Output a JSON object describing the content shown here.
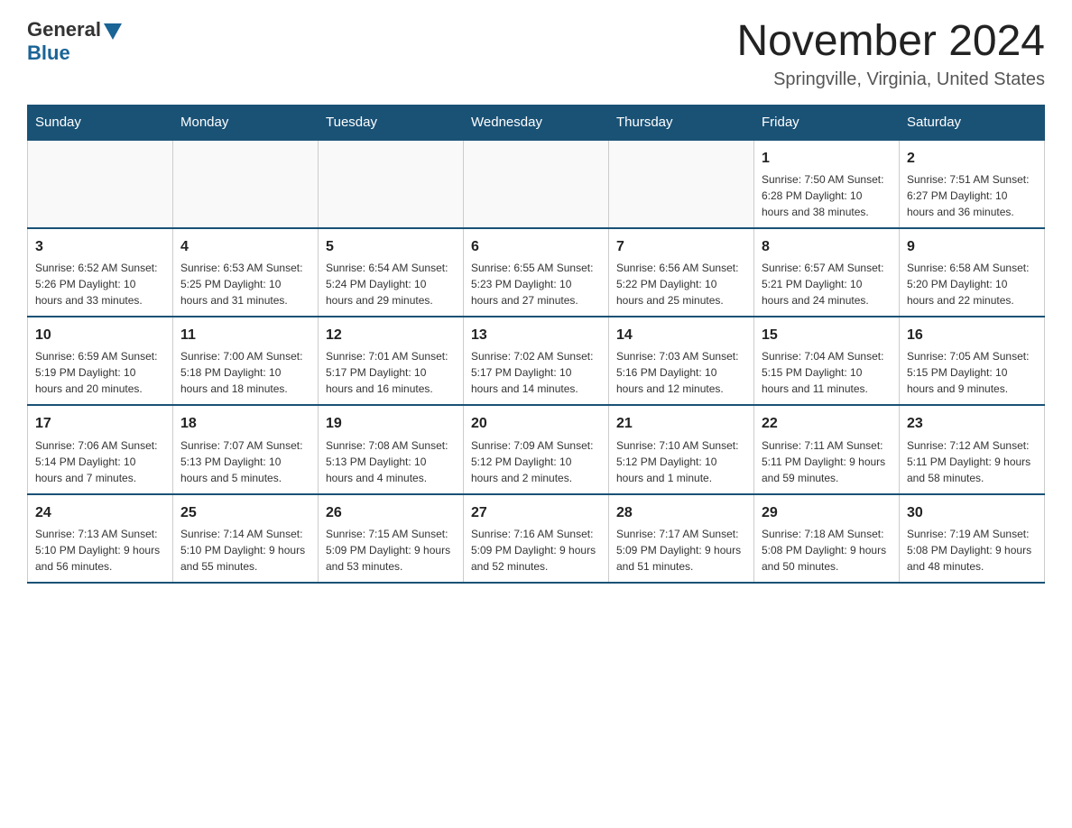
{
  "header": {
    "logo_general": "General",
    "logo_blue": "Blue",
    "title": "November 2024",
    "subtitle": "Springville, Virginia, United States"
  },
  "days_of_week": [
    "Sunday",
    "Monday",
    "Tuesday",
    "Wednesday",
    "Thursday",
    "Friday",
    "Saturday"
  ],
  "weeks": [
    [
      {
        "day": "",
        "info": ""
      },
      {
        "day": "",
        "info": ""
      },
      {
        "day": "",
        "info": ""
      },
      {
        "day": "",
        "info": ""
      },
      {
        "day": "",
        "info": ""
      },
      {
        "day": "1",
        "info": "Sunrise: 7:50 AM\nSunset: 6:28 PM\nDaylight: 10 hours and 38 minutes."
      },
      {
        "day": "2",
        "info": "Sunrise: 7:51 AM\nSunset: 6:27 PM\nDaylight: 10 hours and 36 minutes."
      }
    ],
    [
      {
        "day": "3",
        "info": "Sunrise: 6:52 AM\nSunset: 5:26 PM\nDaylight: 10 hours and 33 minutes."
      },
      {
        "day": "4",
        "info": "Sunrise: 6:53 AM\nSunset: 5:25 PM\nDaylight: 10 hours and 31 minutes."
      },
      {
        "day": "5",
        "info": "Sunrise: 6:54 AM\nSunset: 5:24 PM\nDaylight: 10 hours and 29 minutes."
      },
      {
        "day": "6",
        "info": "Sunrise: 6:55 AM\nSunset: 5:23 PM\nDaylight: 10 hours and 27 minutes."
      },
      {
        "day": "7",
        "info": "Sunrise: 6:56 AM\nSunset: 5:22 PM\nDaylight: 10 hours and 25 minutes."
      },
      {
        "day": "8",
        "info": "Sunrise: 6:57 AM\nSunset: 5:21 PM\nDaylight: 10 hours and 24 minutes."
      },
      {
        "day": "9",
        "info": "Sunrise: 6:58 AM\nSunset: 5:20 PM\nDaylight: 10 hours and 22 minutes."
      }
    ],
    [
      {
        "day": "10",
        "info": "Sunrise: 6:59 AM\nSunset: 5:19 PM\nDaylight: 10 hours and 20 minutes."
      },
      {
        "day": "11",
        "info": "Sunrise: 7:00 AM\nSunset: 5:18 PM\nDaylight: 10 hours and 18 minutes."
      },
      {
        "day": "12",
        "info": "Sunrise: 7:01 AM\nSunset: 5:17 PM\nDaylight: 10 hours and 16 minutes."
      },
      {
        "day": "13",
        "info": "Sunrise: 7:02 AM\nSunset: 5:17 PM\nDaylight: 10 hours and 14 minutes."
      },
      {
        "day": "14",
        "info": "Sunrise: 7:03 AM\nSunset: 5:16 PM\nDaylight: 10 hours and 12 minutes."
      },
      {
        "day": "15",
        "info": "Sunrise: 7:04 AM\nSunset: 5:15 PM\nDaylight: 10 hours and 11 minutes."
      },
      {
        "day": "16",
        "info": "Sunrise: 7:05 AM\nSunset: 5:15 PM\nDaylight: 10 hours and 9 minutes."
      }
    ],
    [
      {
        "day": "17",
        "info": "Sunrise: 7:06 AM\nSunset: 5:14 PM\nDaylight: 10 hours and 7 minutes."
      },
      {
        "day": "18",
        "info": "Sunrise: 7:07 AM\nSunset: 5:13 PM\nDaylight: 10 hours and 5 minutes."
      },
      {
        "day": "19",
        "info": "Sunrise: 7:08 AM\nSunset: 5:13 PM\nDaylight: 10 hours and 4 minutes."
      },
      {
        "day": "20",
        "info": "Sunrise: 7:09 AM\nSunset: 5:12 PM\nDaylight: 10 hours and 2 minutes."
      },
      {
        "day": "21",
        "info": "Sunrise: 7:10 AM\nSunset: 5:12 PM\nDaylight: 10 hours and 1 minute."
      },
      {
        "day": "22",
        "info": "Sunrise: 7:11 AM\nSunset: 5:11 PM\nDaylight: 9 hours and 59 minutes."
      },
      {
        "day": "23",
        "info": "Sunrise: 7:12 AM\nSunset: 5:11 PM\nDaylight: 9 hours and 58 minutes."
      }
    ],
    [
      {
        "day": "24",
        "info": "Sunrise: 7:13 AM\nSunset: 5:10 PM\nDaylight: 9 hours and 56 minutes."
      },
      {
        "day": "25",
        "info": "Sunrise: 7:14 AM\nSunset: 5:10 PM\nDaylight: 9 hours and 55 minutes."
      },
      {
        "day": "26",
        "info": "Sunrise: 7:15 AM\nSunset: 5:09 PM\nDaylight: 9 hours and 53 minutes."
      },
      {
        "day": "27",
        "info": "Sunrise: 7:16 AM\nSunset: 5:09 PM\nDaylight: 9 hours and 52 minutes."
      },
      {
        "day": "28",
        "info": "Sunrise: 7:17 AM\nSunset: 5:09 PM\nDaylight: 9 hours and 51 minutes."
      },
      {
        "day": "29",
        "info": "Sunrise: 7:18 AM\nSunset: 5:08 PM\nDaylight: 9 hours and 50 minutes."
      },
      {
        "day": "30",
        "info": "Sunrise: 7:19 AM\nSunset: 5:08 PM\nDaylight: 9 hours and 48 minutes."
      }
    ]
  ]
}
